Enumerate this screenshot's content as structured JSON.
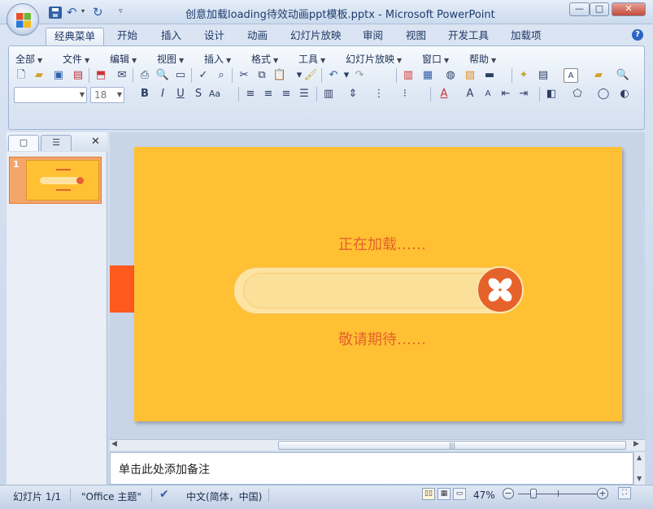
{
  "window": {
    "title": "创意加载loading待效动画ppt模板.pptx - Microsoft PowerPoint",
    "controls": {
      "minimize": "—",
      "maximize": "□",
      "close": "✕"
    }
  },
  "tabs": [
    "经典菜单",
    "开始",
    "插入",
    "设计",
    "动画",
    "幻灯片放映",
    "审阅",
    "视图",
    "开发工具",
    "加载项"
  ],
  "menus": [
    "全部",
    "文件",
    "编辑",
    "视图",
    "插入",
    "格式",
    "工具",
    "幻灯片放映",
    "窗口",
    "帮助"
  ],
  "font": {
    "name": "",
    "size": "18"
  },
  "panel": {
    "close": "✕",
    "thumbnail_number": "1"
  },
  "slide": {
    "loading_text": "正在加载……",
    "waiting_text": "敬请期待……",
    "colors": {
      "background": "#ffc133",
      "accent": "#e6612c",
      "track": "#fde4a2"
    }
  },
  "notes": {
    "placeholder": "单击此处添加备注"
  },
  "status": {
    "slide_index": "幻灯片 1/1",
    "theme": "\"Office 主题\"",
    "language": "中文(简体，中国)",
    "zoom": "47%"
  }
}
